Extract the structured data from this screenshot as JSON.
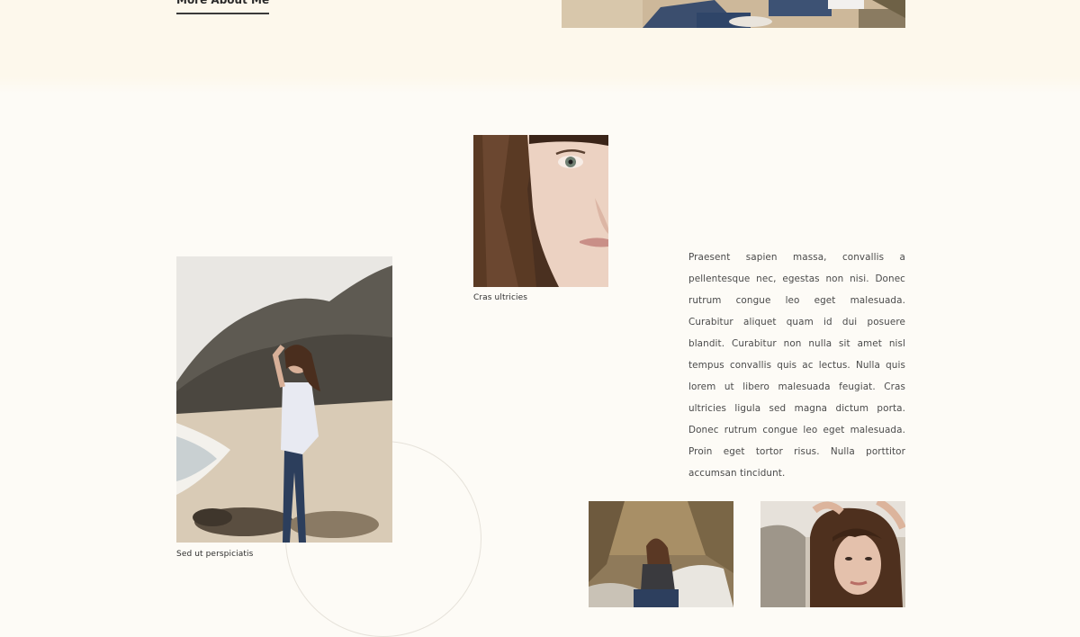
{
  "hero": {
    "more_link_label": "More About Me"
  },
  "gallery": {
    "face_caption": "Cras ultricies",
    "beach_caption": "Sed ut perspiciatis"
  },
  "article": {
    "paragraph": "Praesent sapien massa, convallis a pellentesque nec, egestas non nisi. Donec rutrum congue leo eget malesuada. Curabitur aliquet quam id dui posuere blandit. Curabitur non nulla sit amet nisl tempus convallis quis ac lectus. Nulla quis lorem ut libero malesuada feugiat. Cras ultricies ligula sed magna dictum porta. Donec rutrum congue leo eget malesuada. Proin eget tortor risus. Nulla porttitor accumsan tincidunt."
  },
  "colors": {
    "page_background": "#fdfbf6",
    "top_band": "#fdf8ec",
    "text": "#4a4a4a"
  }
}
